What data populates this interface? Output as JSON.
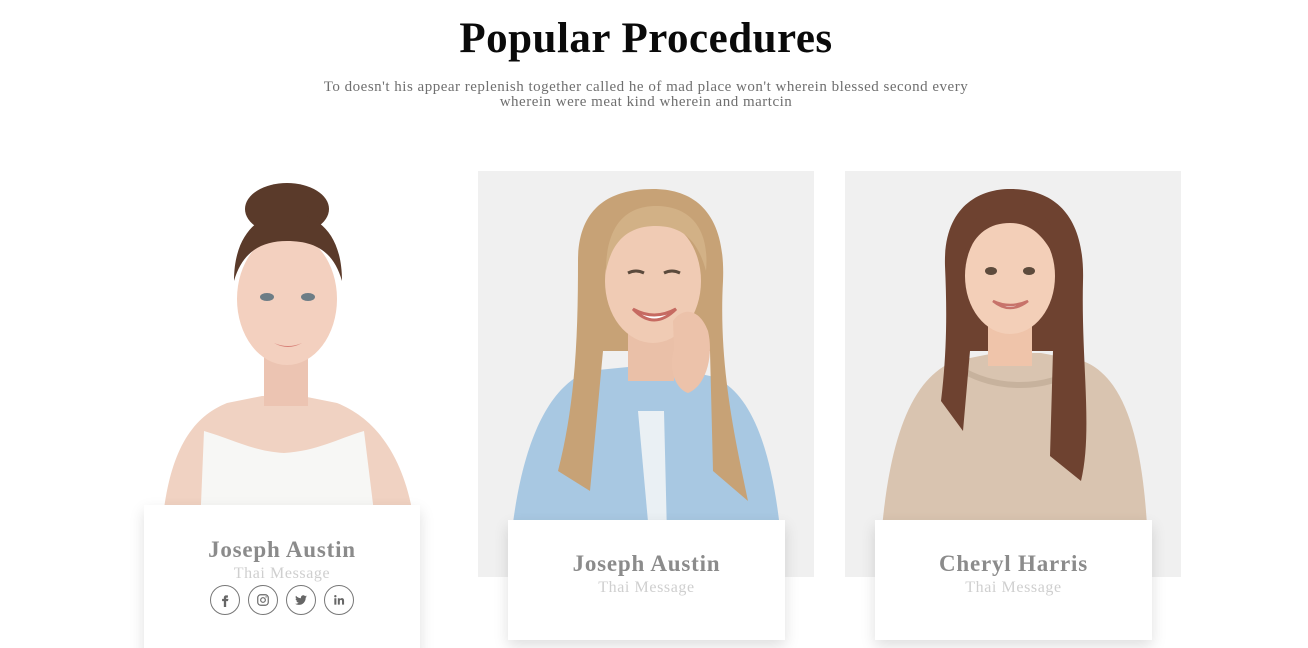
{
  "section": {
    "title": "Popular Procedures",
    "subtitle": "To doesn't his appear replenish together called he of mad place won't wherein blessed second every wherein were meat kind wherein and martcin"
  },
  "cards": [
    {
      "name": "Joseph Austin",
      "role": "Thai Message",
      "socials": [
        {
          "icon": "facebook-icon"
        },
        {
          "icon": "instagram-icon"
        },
        {
          "icon": "twitter-icon"
        },
        {
          "icon": "linkedin-icon"
        }
      ]
    },
    {
      "name": "Joseph Austin",
      "role": "Thai Message"
    },
    {
      "name": "Cheryl Harris",
      "role": "Thai Message"
    }
  ],
  "colors": {
    "title": "#0a0a0a",
    "name": "#8b8b8b",
    "role": "#cfcfcf",
    "photo_bg": "#f0f0f0"
  }
}
